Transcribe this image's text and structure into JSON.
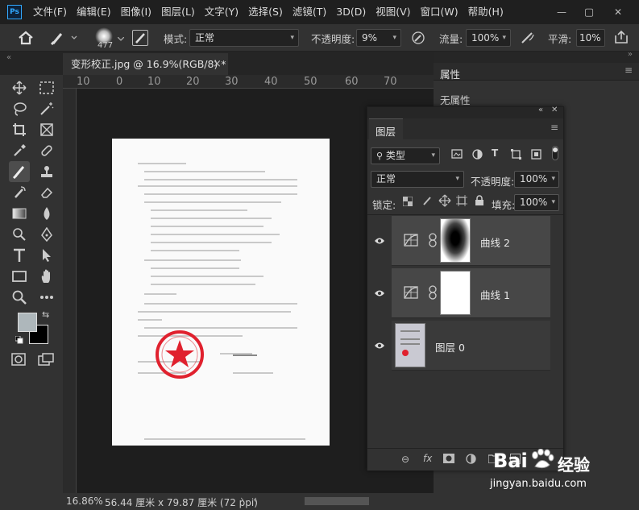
{
  "menubar": {
    "logo": "Ps",
    "items": [
      "文件(F)",
      "编辑(E)",
      "图像(I)",
      "图层(L)",
      "文字(Y)",
      "选择(S)",
      "滤镜(T)",
      "3D(D)",
      "视图(V)",
      "窗口(W)",
      "帮助(H)"
    ],
    "minimize": "—",
    "maximize": "▢",
    "close": "✕"
  },
  "options": {
    "brush_size": "477",
    "mode_label": "模式:",
    "mode_value": "正常",
    "opacity_label": "不透明度:",
    "opacity_value": "9%",
    "flow_label": "流量:",
    "flow_value": "100%",
    "smooth_label": "平滑:",
    "smooth_value": "10%"
  },
  "tab": {
    "title": "变形校正.jpg @ 16.9%(RGB/8) *",
    "close": "×"
  },
  "ruler": {
    "labels": [
      "10",
      "0",
      "10",
      "20",
      "30",
      "40",
      "50",
      "60",
      "70"
    ]
  },
  "status": {
    "zoom": "16.86%",
    "size": "56.44 厘米 x 79.87 厘米 (72 ppi)"
  },
  "properties": {
    "title": "属性",
    "body": "无属性"
  },
  "layers": {
    "title": "图层",
    "filter_label": "类型",
    "blend_mode": "正常",
    "opacity_label": "不透明度:",
    "opacity_value": "100%",
    "lock_label": "锁定:",
    "fill_label": "填充:",
    "fill_value": "100%",
    "rows": [
      {
        "name": "曲线 2"
      },
      {
        "name": "曲线 1"
      },
      {
        "name": "图层 0"
      }
    ]
  },
  "watermark": {
    "brand": "Bai",
    "brand2": "经验",
    "url": "jingyan.baidu.com"
  },
  "colors": {
    "accent": "#31a8ff",
    "stamp": "#e0212e"
  }
}
